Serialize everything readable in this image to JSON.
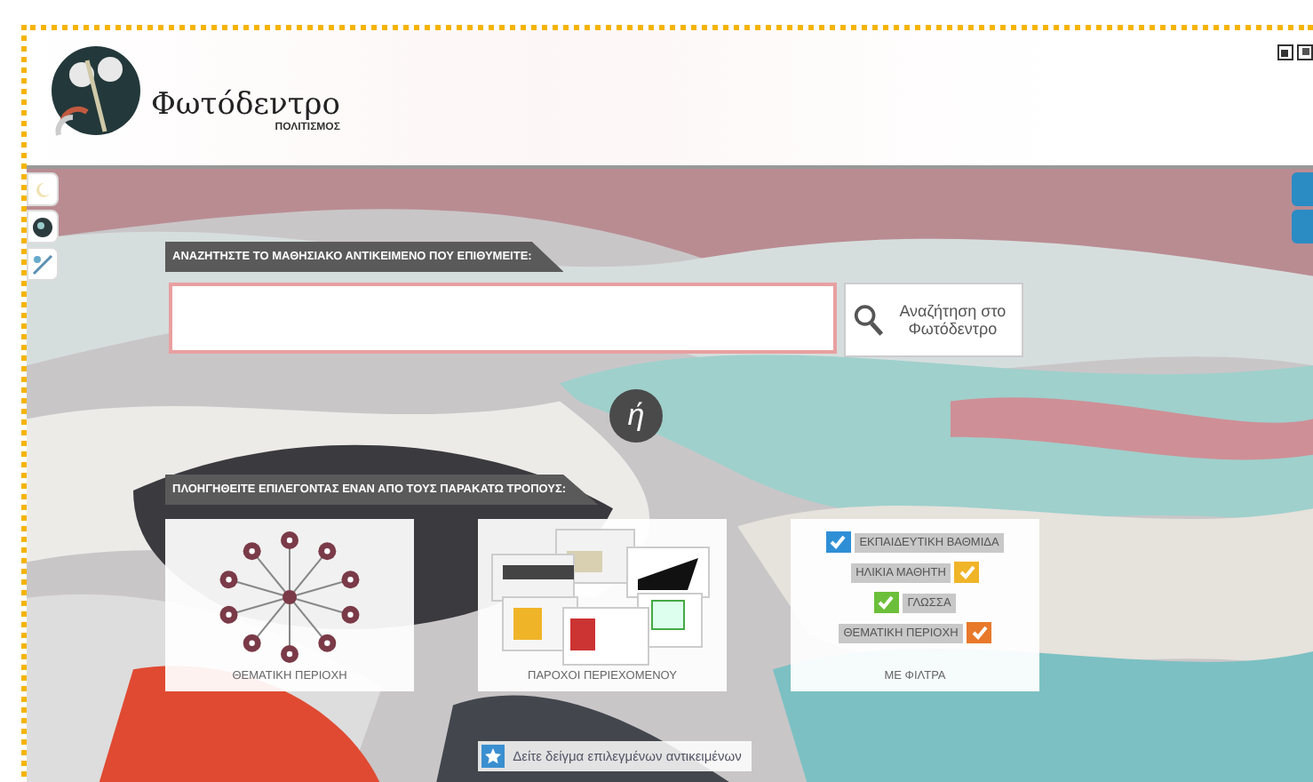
{
  "header": {
    "logo_title": "Φωτόδεντρο",
    "logo_subtitle": "ΠΟΛΙΤΙΣΜΟΣ"
  },
  "search": {
    "label": "ΑΝΑΖΗΤΗΣΤΕ ΤΟ ΜΑΘΗΣΙΑΚΟ ΑΝΤΙΚΕΙΜΕΝΟ ΠΟΥ ΕΠΙΘΥΜΕΙΤΕ:",
    "button": "Αναζήτηση στο Φωτόδεντρο"
  },
  "or_label": "ή",
  "browse": {
    "label": "ΠΛΟΗΓΗΘΕΙΤΕ ΕΠΙΛΕΓΟΝΤΑΣ ΕΝΑΝ ΑΠΟ ΤΟΥΣ ΠΑΡΑΚΑΤΩ ΤΡΟΠΟΥΣ:",
    "cards": [
      {
        "kind": "topics",
        "caption": "ΘΕΜΑΤΙΚΗ ΠΕΡΙΟΧΗ"
      },
      {
        "kind": "providers",
        "caption": "ΠΑΡΟΧΟΙ ΠΕΡΙΕΧΟΜΕΝΟΥ"
      },
      {
        "kind": "filters",
        "caption": "ΜΕ ΦΙΛΤΡΑ",
        "filters": [
          {
            "label": "ΕΚΠΑΙΔΕΥΤΙΚΗ ΒΑΘΜΙΔΑ",
            "color": "#2f8fd6",
            "kind": "check_left"
          },
          {
            "label": "ΗΛΙΚΙΑ ΜΑΘΗΤΗ",
            "color": "#f0b429",
            "kind": "check_right"
          },
          {
            "label": "ΓΛΩΣΣΑ",
            "color": "#6cbf3a",
            "kind": "check_left"
          },
          {
            "label": "ΘΕΜΑΤΙΚΗ ΠΕΡΙΟΧΗ",
            "color": "#e8792a",
            "kind": "check_right"
          }
        ]
      }
    ]
  },
  "featured_button": "Δείτε δείγμα επιλεγμένων αντικειμένων"
}
